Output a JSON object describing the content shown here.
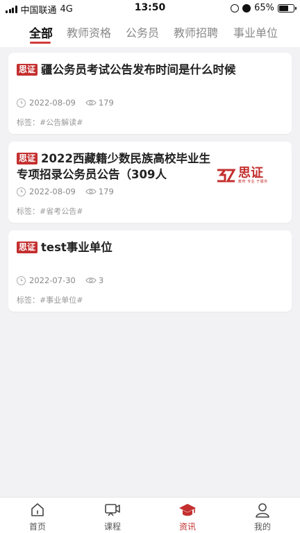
{
  "status_bar": {
    "carrier": "中国联通",
    "network": "4G",
    "time": "13:50",
    "battery": "65%",
    "battery_level": 0.65
  },
  "tabs": [
    {
      "label": "全部",
      "active": true
    },
    {
      "label": "教师资格",
      "active": false
    },
    {
      "label": "公务员",
      "active": false
    },
    {
      "label": "教师招聘",
      "active": false
    },
    {
      "label": "事业单位",
      "active": false
    }
  ],
  "badge_label": "思证",
  "articles": [
    {
      "title": "疆公务员考试公告发布时间是什么时候",
      "date": "2022-08-09",
      "views": "179",
      "tags": "标签：#公告解读#"
    },
    {
      "title": "2022西藏籍少数民族高校毕业生专项招录公务员公告（309人",
      "date": "2022-08-09",
      "views": "179",
      "tags": "标签：#省考公告#",
      "thumbnail": {
        "brand_mark": "SZ",
        "brand_name": "思证",
        "slogan": "教育 专业 于服务"
      }
    },
    {
      "title": "test事业单位",
      "date": "2022-07-30",
      "views": "3",
      "tags": "标签：#事业单位#"
    }
  ],
  "bottom_nav": [
    {
      "label": "首页",
      "icon": "home-icon",
      "active": false
    },
    {
      "label": "课程",
      "icon": "video-icon",
      "active": false
    },
    {
      "label": "资讯",
      "icon": "graduation-cap-icon",
      "active": true
    },
    {
      "label": "我的",
      "icon": "user-icon",
      "active": false
    }
  ],
  "colors": {
    "accent": "#c42f2f",
    "tab_indicator": "#d23a3a",
    "background": "#f2f2f4",
    "card": "#ffffff"
  }
}
